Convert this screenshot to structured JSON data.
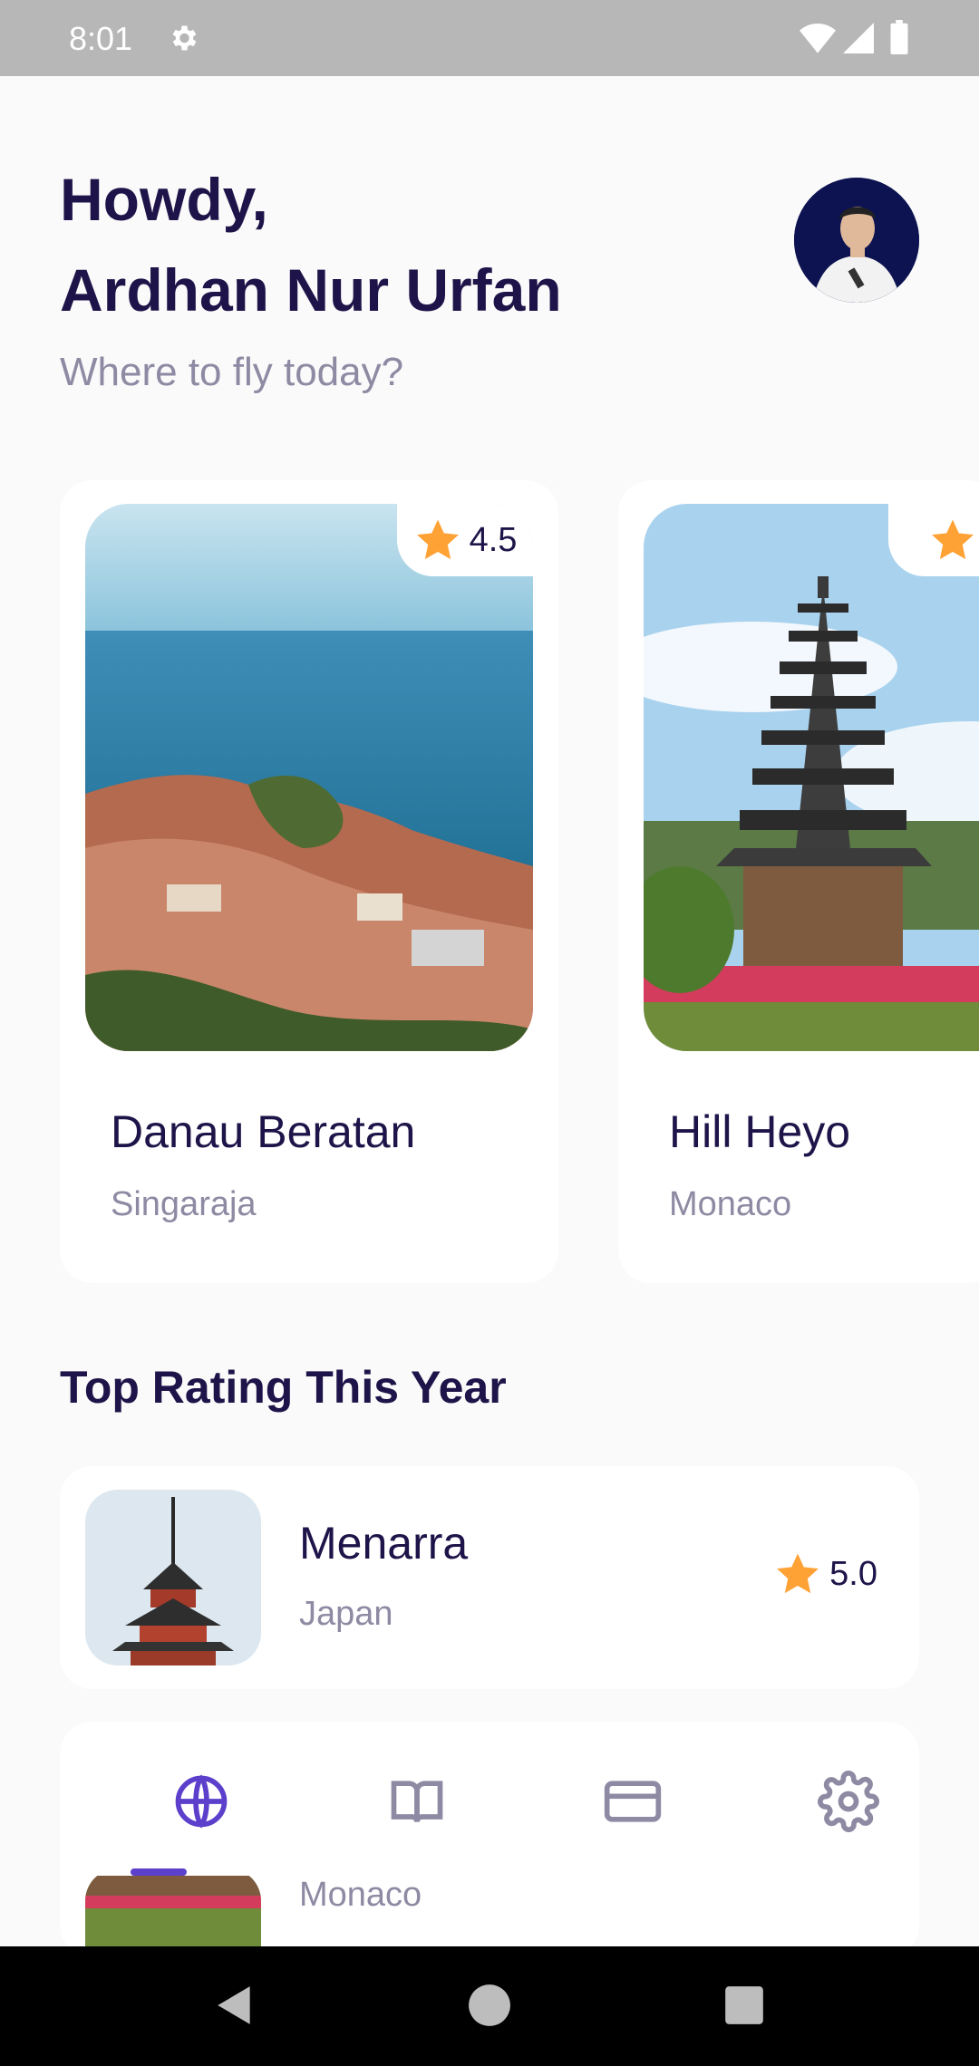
{
  "status_bar": {
    "time": "8:01"
  },
  "header": {
    "greeting_line1": "Howdy,",
    "greeting_line2": "Ardhan Nur Urfan",
    "subtitle": "Where to fly today?"
  },
  "destinations": [
    {
      "title": "Danau Beratan",
      "location": "Singaraja",
      "rating": "4.5"
    },
    {
      "title": "Hill Heyo",
      "location": "Monaco",
      "rating": ""
    }
  ],
  "section": {
    "title": "Top Rating This Year"
  },
  "top_rating": [
    {
      "title": "Menarra",
      "location": "Japan",
      "rating": "5.0"
    },
    {
      "title": "",
      "location": "Monaco",
      "rating": ""
    }
  ],
  "bottom_nav": {
    "items": [
      "globe-icon",
      "book-icon",
      "credit-card-icon",
      "gear-icon"
    ],
    "active_index": 0,
    "active_color": "#5C40CC",
    "inactive_color": "#8E8AA3"
  },
  "colors": {
    "primary_text": "#1F1449",
    "secondary_text": "#8E8AA3",
    "star": "#FFA235",
    "accent": "#5C40CC",
    "background": "#FAFAFA"
  }
}
